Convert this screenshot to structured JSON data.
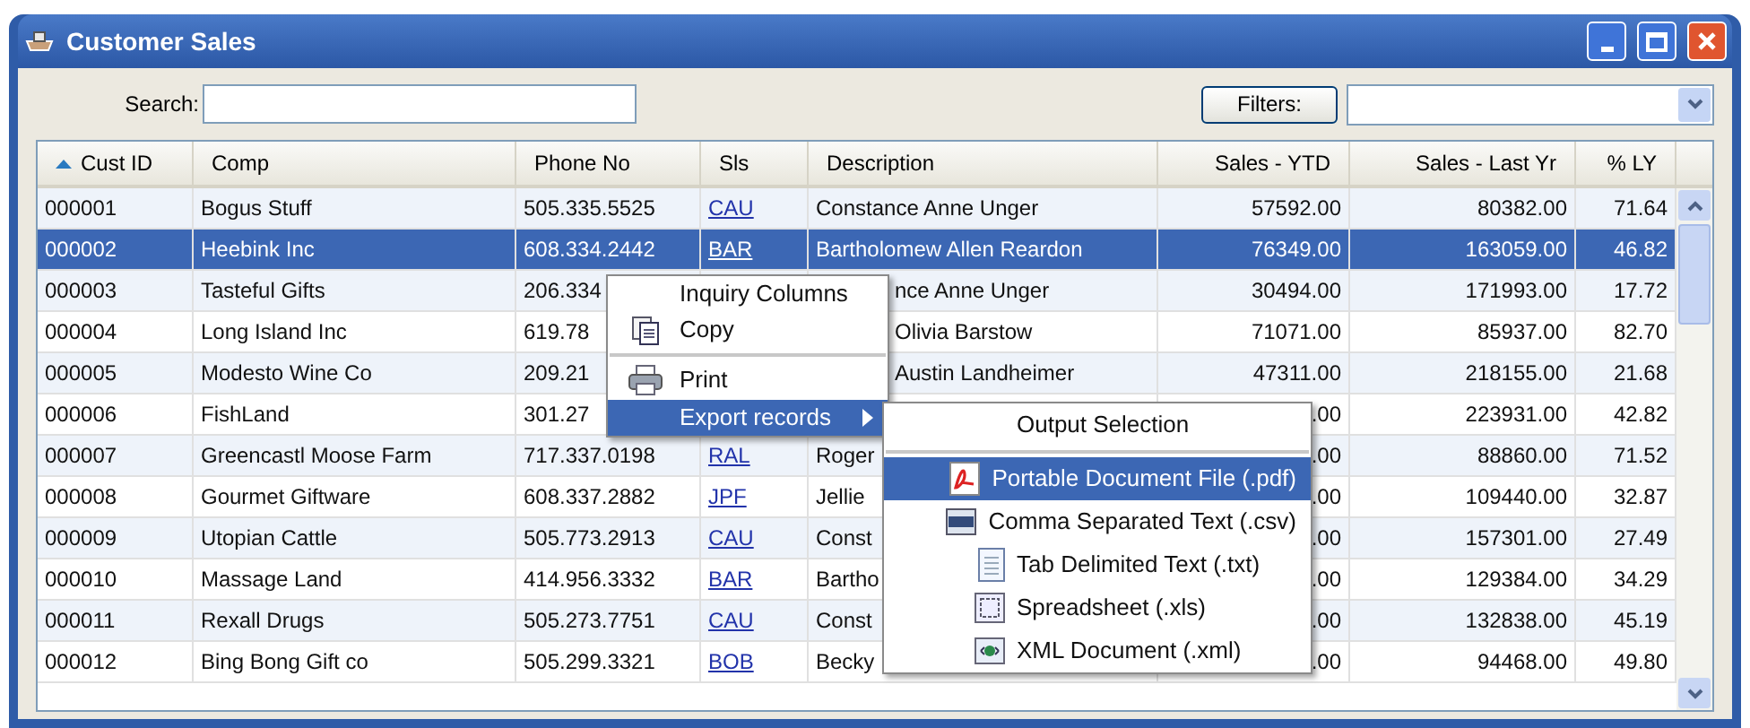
{
  "window": {
    "title": "Customer Sales"
  },
  "toolbar": {
    "search_label": "Search:",
    "filters_button": "Filters:"
  },
  "table": {
    "columns": [
      {
        "label": "Cust ID",
        "sorted": true
      },
      {
        "label": "Comp",
        "sorted": false
      },
      {
        "label": "Phone No",
        "sorted": false
      },
      {
        "label": "Sls",
        "sorted": false
      },
      {
        "label": "Description",
        "sorted": false
      },
      {
        "label": "Sales - YTD",
        "sorted": false
      },
      {
        "label": "Sales - Last Yr",
        "sorted": false
      },
      {
        "label": "% LY",
        "sorted": false
      }
    ],
    "rows": [
      {
        "selected": false,
        "cells": [
          "000001",
          "Bogus Stuff",
          "505.335.5525",
          "CAU",
          "Constance Anne Unger",
          "57592.00",
          "80382.00",
          "71.64"
        ]
      },
      {
        "selected": true,
        "cells": [
          "000002",
          "Heebink Inc",
          "608.334.2442",
          "BAR",
          "Bartholomew Allen Reardon",
          "76349.00",
          "163059.00",
          "46.82"
        ]
      },
      {
        "selected": false,
        "cells": [
          "000003",
          "Tasteful Gifts",
          "206.334",
          null,
          "nce Anne Unger",
          "30494.00",
          "171993.00",
          "17.72"
        ]
      },
      {
        "selected": false,
        "cells": [
          "000004",
          "Long Island Inc",
          "619.78",
          null,
          "Olivia Barstow",
          "71071.00",
          "85937.00",
          "82.70"
        ]
      },
      {
        "selected": false,
        "cells": [
          "000005",
          "Modesto Wine Co",
          "209.21",
          null,
          "Austin Landheimer",
          "47311.00",
          "218155.00",
          "21.68"
        ]
      },
      {
        "selected": false,
        "cells": [
          "000006",
          "FishLand",
          "301.27",
          null,
          null,
          ".00",
          "223931.00",
          "42.82"
        ]
      },
      {
        "selected": false,
        "cells": [
          "000007",
          "Greencastl Moose Farm",
          "717.337.0198",
          "RAL",
          "Roger",
          ".00",
          "88860.00",
          "71.52"
        ]
      },
      {
        "selected": false,
        "cells": [
          "000008",
          "Gourmet Giftware",
          "608.337.2882",
          "JPF",
          "Jellie",
          ".00",
          "109440.00",
          "32.87"
        ]
      },
      {
        "selected": false,
        "cells": [
          "000009",
          "Utopian Cattle",
          "505.773.2913",
          "CAU",
          "Const",
          ".00",
          "157301.00",
          "27.49"
        ]
      },
      {
        "selected": false,
        "cells": [
          "000010",
          "Massage Land",
          "414.956.3332",
          "BAR",
          "Bartho",
          ".00",
          "129384.00",
          "34.29"
        ]
      },
      {
        "selected": false,
        "cells": [
          "000011",
          "Rexall Drugs",
          "505.273.7751",
          "CAU",
          "Const",
          ".00",
          "132838.00",
          "45.19"
        ]
      },
      {
        "selected": false,
        "cells": [
          "000012",
          "Bing Bong Gift co",
          "505.299.3321",
          "BOB",
          "Becky",
          ".00",
          "94468.00",
          "49.80"
        ]
      }
    ]
  },
  "context_menu": {
    "items": [
      {
        "kind": "item",
        "label": "Inquiry Columns",
        "selected": false
      },
      {
        "kind": "item",
        "label": "Copy",
        "selected": false
      },
      {
        "kind": "separator"
      },
      {
        "kind": "item",
        "label": "Print",
        "selected": false
      },
      {
        "kind": "submenu",
        "label": "Export records",
        "selected": true
      }
    ]
  },
  "submenu": {
    "items": [
      {
        "kind": "item",
        "label": "Output Selection",
        "selected": false
      },
      {
        "kind": "separator"
      },
      {
        "kind": "item",
        "label": "Portable Document File (.pdf)",
        "selected": true
      },
      {
        "kind": "item",
        "label": "Comma Separated Text (.csv)",
        "selected": false
      },
      {
        "kind": "item",
        "label": "Tab Delimited Text (.txt)",
        "selected": false
      },
      {
        "kind": "item",
        "label": "Spreadsheet (.xls)",
        "selected": false
      },
      {
        "kind": "item",
        "label": "XML Document (.xml)",
        "selected": false
      }
    ]
  }
}
